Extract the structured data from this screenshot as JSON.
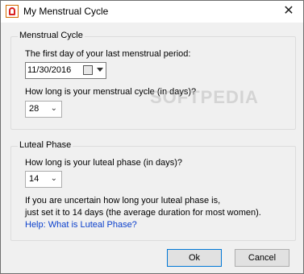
{
  "window": {
    "title": "My Menstrual Cycle",
    "close_glyph": "✕"
  },
  "cycle_group": {
    "legend": "Menstrual Cycle",
    "first_day_label": "The first day of your last menstrual period:",
    "first_day_value": "11/30/2016",
    "length_label": "How long is your menstrual cycle (in days)?",
    "length_value": "28"
  },
  "luteal_group": {
    "legend": "Luteal Phase",
    "length_label": "How long is your luteal phase (in days)?",
    "length_value": "14",
    "note_line1": "If you are uncertain how long your luteal phase is,",
    "note_line2": "just set it to 14 days (the average duration for most women).",
    "help_link": "Help: What is Luteal Phase?"
  },
  "buttons": {
    "ok": "Ok",
    "cancel": "Cancel"
  },
  "watermark": "SOFTPEDIA",
  "icons": {
    "app": "cycle-app-icon",
    "calendar": "calendar-icon",
    "dropdown": "chevron-down-icon"
  },
  "colors": {
    "link": "#0a3fcc",
    "default_button_border": "#0078d7"
  }
}
